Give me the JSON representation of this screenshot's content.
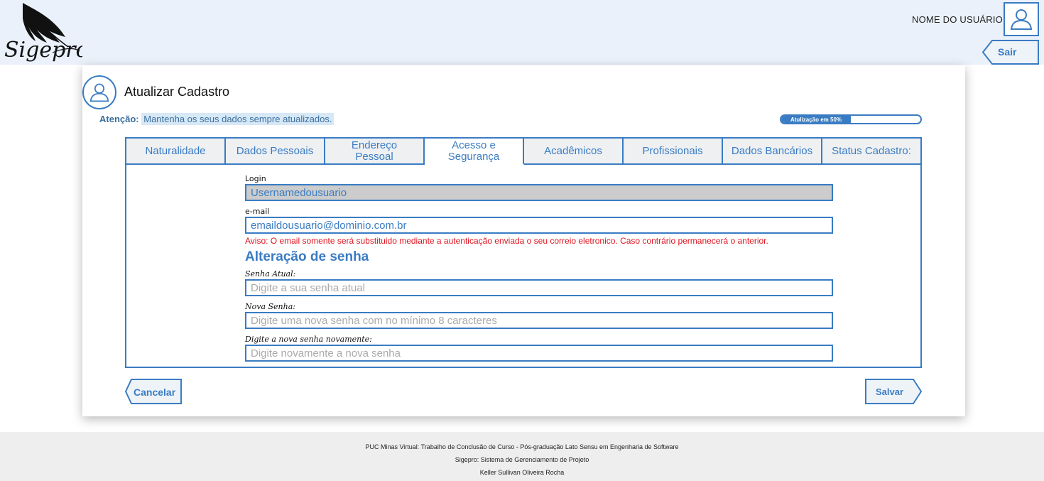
{
  "header": {
    "logo_text": "Sigepro",
    "user_name": "NOME DO USUÁRIO",
    "logout_label": "Sair"
  },
  "card": {
    "title": "Atualizar Cadastro",
    "attention_label": "Atenção:",
    "attention_message": "Mantenha os seus dados sempre atualizados.",
    "progress": {
      "label": "Atulização em 50%",
      "percent": 50
    }
  },
  "tabs": [
    {
      "label": "Naturalidade",
      "active": false
    },
    {
      "label": "Dados Pessoais",
      "active": false
    },
    {
      "label": "Endereço Pessoal",
      "active": false
    },
    {
      "label": "Acesso e Segurança",
      "active": true
    },
    {
      "label": "Acadêmicos",
      "active": false
    },
    {
      "label": "Profissionais",
      "active": false
    },
    {
      "label": "Dados Bancários",
      "active": false
    },
    {
      "label": "Status Cadastro:",
      "active": false
    }
  ],
  "form": {
    "login_label": "Login",
    "login_value": "Usernamedousuario",
    "email_label": "e-mail",
    "email_value": "emaildousuario@dominio.com.br",
    "email_warning": "Aviso: O email somente será substituido mediante a autenticação enviada o seu correio eletronico. Caso contrário permanecerá o anterior.",
    "password_section_title": "Alteração de senha",
    "current_password_label": "Senha Atual:",
    "current_password_placeholder": "Digite a sua senha atual",
    "new_password_label": "Nova Senha:",
    "new_password_placeholder": "Digite uma nova senha com no mínimo 8 caracteres",
    "confirm_password_label": "Digite a nova senha novamente:",
    "confirm_password_placeholder": "Digite novamente a nova senha"
  },
  "actions": {
    "cancel_label": "Cancelar",
    "save_label": "Salvar"
  },
  "footer": {
    "line1": "PUC Minas Virtual: Trabalho de Conclusão de Curso - Pós-graduação Lato Sensu em Engenharia de Software",
    "line2": "Sigepro: Sistema de Gerenciamento de Projeto",
    "line3": "Keller Sullivan Oliveira Rocha"
  },
  "colors": {
    "accent": "#3a7cc3",
    "warning": "#e0141e",
    "header_bg": "#eaf1fa",
    "footer_bg": "#eeeeee"
  }
}
